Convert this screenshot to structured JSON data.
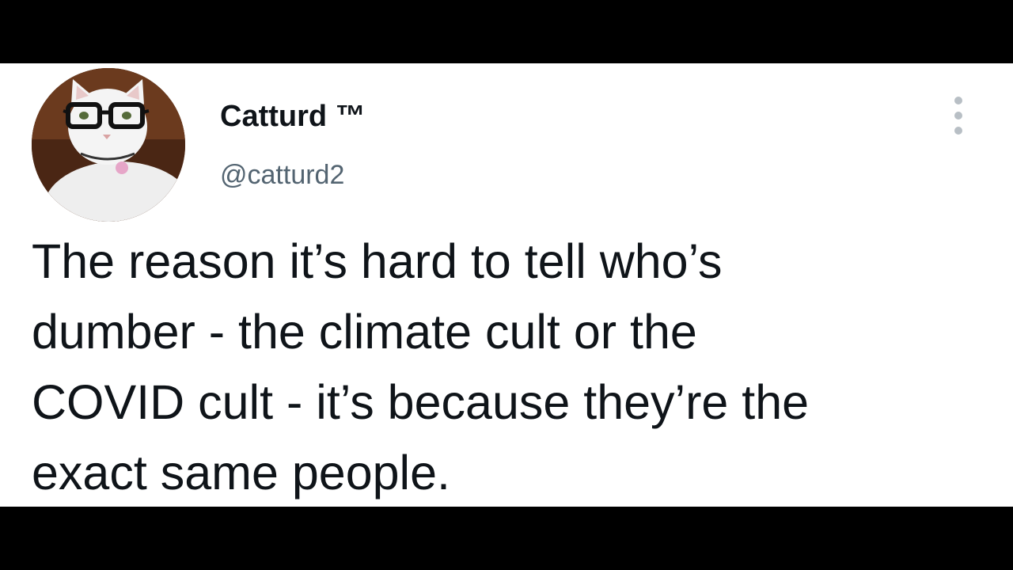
{
  "tweet": {
    "author": {
      "display_name": "Catturd ™",
      "handle": "@catturd2",
      "avatar_icon": "cat-with-glasses-avatar-icon"
    },
    "more_icon": "more-options-vertical-dots-icon",
    "text_lines": [
      "The reason it’s hard to tell who’s",
      "dumber - the climate cult or the",
      "COVID cult - it’s because they’re the",
      "exact same people."
    ]
  },
  "colors": {
    "background": "#ffffff",
    "letterbox": "#000000",
    "text_primary": "#0f1419",
    "text_secondary": "#536471"
  }
}
